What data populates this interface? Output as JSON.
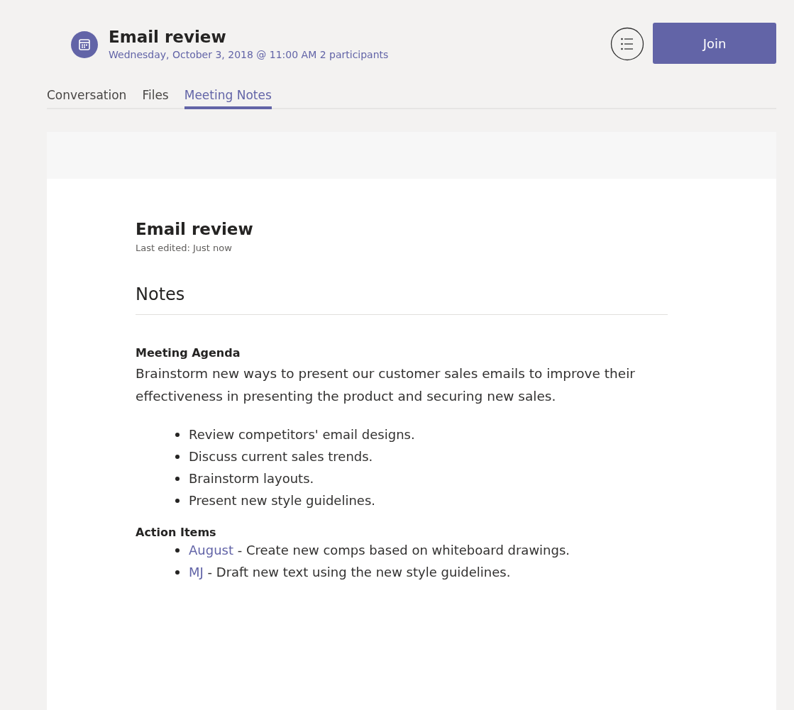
{
  "meeting": {
    "title": "Email review",
    "subtitle": "Wednesday, October 3, 2018 @ 11:00 AM 2 participants"
  },
  "join_button": "Join",
  "tabs": [
    {
      "label": "Conversation",
      "selected": false
    },
    {
      "label": "Files",
      "selected": false
    },
    {
      "label": "Meeting Notes",
      "selected": true
    }
  ],
  "notes": {
    "title": "Email review",
    "last_edited": "Last edited: Just now",
    "heading": "Notes",
    "agenda_heading": "Meeting Agenda",
    "agenda_text": "Brainstorm new ways to present our customer sales emails to improve their effectiveness in presenting the product and securing new sales.",
    "agenda_items": [
      "Review competitors' email designs.",
      "Discuss current sales trends.",
      "Brainstorm layouts.",
      "Present new style guidelines."
    ],
    "action_heading": "Action Items",
    "action_items": [
      {
        "assignee": "August",
        "text": " - Create new comps based on whiteboard drawings."
      },
      {
        "assignee": "MJ",
        "text": " - Draft new text using the new style guidelines."
      }
    ]
  }
}
